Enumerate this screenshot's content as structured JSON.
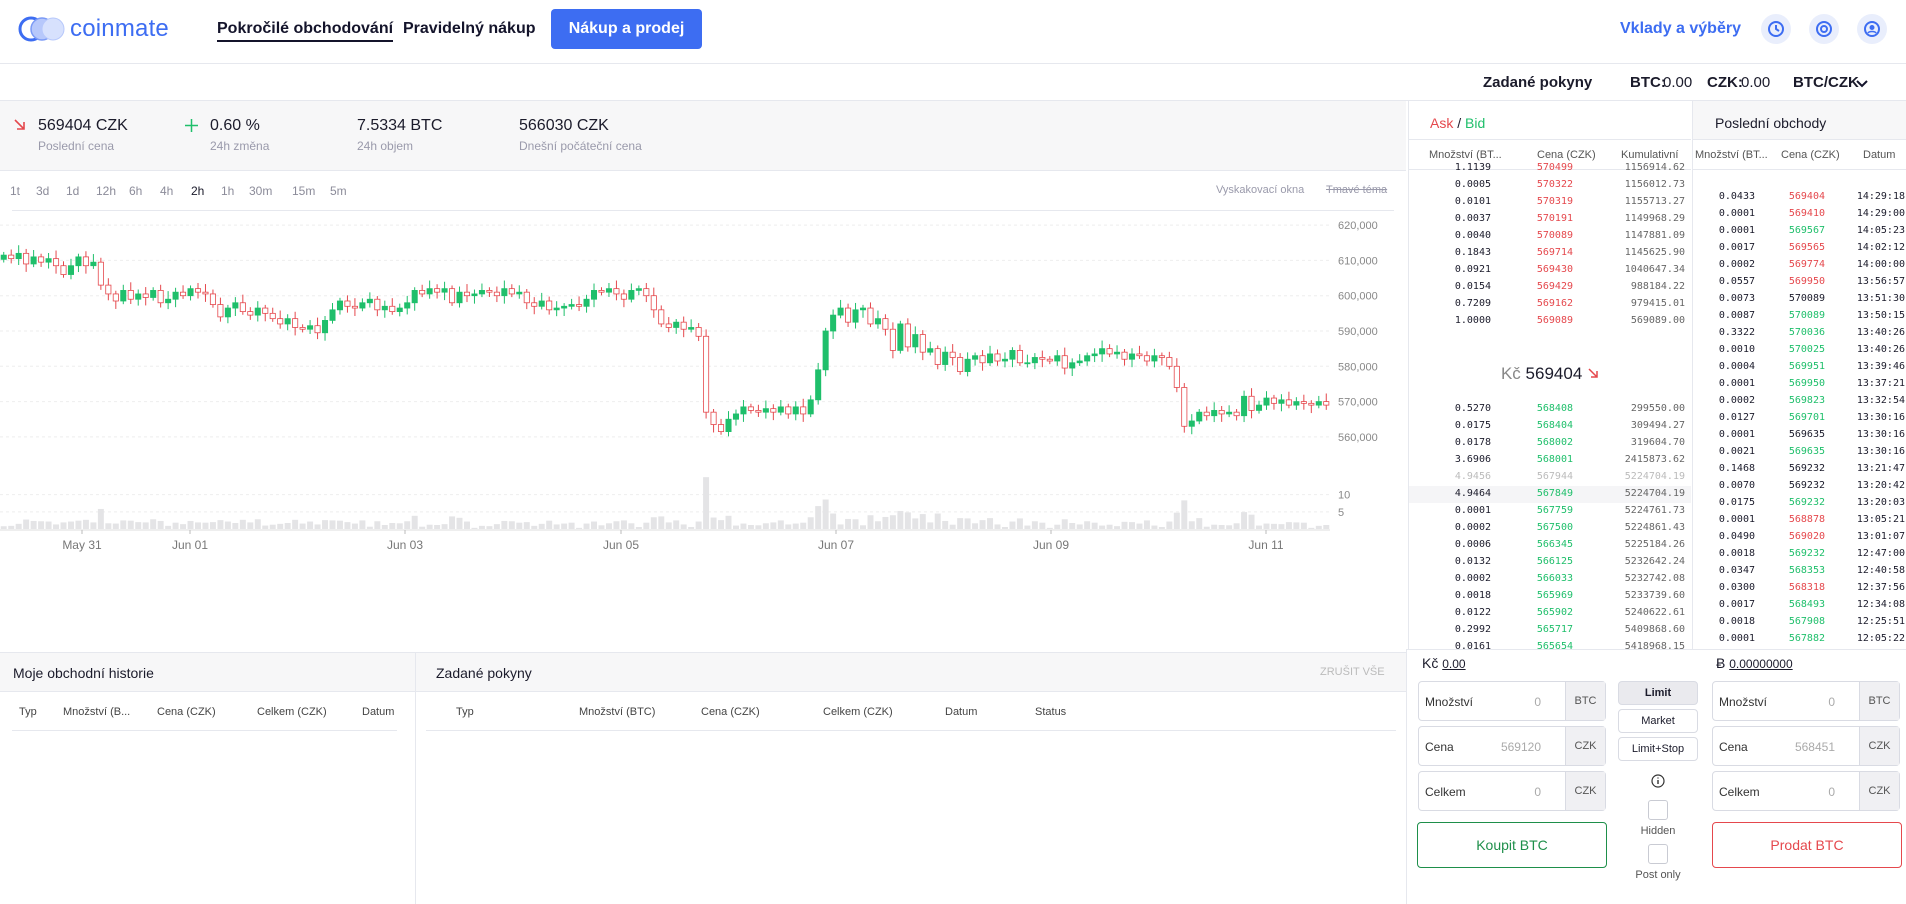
{
  "header": {
    "logo": "coinmate",
    "nav": [
      "Pokročilé obchodování",
      "Pravidelný nákup"
    ],
    "cta": "Nákup a prodej",
    "deposits": "Vklady a výběry",
    "icons": [
      "history-icon",
      "support-icon",
      "account-icon"
    ]
  },
  "subbar": {
    "orders": "Zadané pokyny",
    "btc_label": "BTC:",
    "btc_val": "0.00",
    "czk_label": "CZK:",
    "czk_val": "0.00",
    "pair": "BTC/CZK"
  },
  "ticker": [
    {
      "value": "569404 CZK",
      "label": "Poslední cena",
      "icon": "arrow-down-right-icon"
    },
    {
      "value": "0.60 %",
      "label": "24h změna",
      "icon": "plus-icon"
    },
    {
      "value": "7.5334 BTC",
      "label": "24h objem",
      "icon": ""
    },
    {
      "value": "566030 CZK",
      "label": "Dnešní počáteční cena",
      "icon": ""
    }
  ],
  "chart_controls": {
    "timeframes": [
      "1t",
      "3d",
      "1d",
      "12h",
      "6h",
      "4h",
      "2h",
      "1h",
      "30m",
      "15m",
      "5m"
    ],
    "active": "2h",
    "popup": "Vyskakovací okna",
    "dark": "Tmavé téma"
  },
  "chart_data": {
    "type": "candlestick",
    "x_tick_labels": [
      "May 31",
      "Jun 01",
      "Jun 03",
      "Jun 05",
      "Jun 07",
      "Jun 09",
      "Jun 11"
    ],
    "y_tick_labels": [
      "620,000",
      "610,000",
      "600,000",
      "590,000",
      "580,000",
      "570,000",
      "560,000"
    ],
    "volume_tick_labels": [
      "10",
      "5"
    ],
    "ylim": [
      556000,
      624000
    ],
    "volume_ylim": [
      0,
      16
    ],
    "close": [
      611500,
      610500,
      612000,
      609000,
      611000,
      609500,
      610500,
      608500,
      606000,
      608500,
      611000,
      608500,
      609500,
      603000,
      600500,
      598500,
      601500,
      599000,
      600500,
      599500,
      601500,
      598000,
      599000,
      601000,
      600000,
      602000,
      601000,
      600500,
      597500,
      594000,
      596500,
      598000,
      595500,
      594500,
      596500,
      595000,
      593500,
      592000,
      593500,
      591000,
      590500,
      591500,
      589500,
      593000,
      596000,
      598500,
      597000,
      596500,
      598000,
      599000,
      596000,
      597000,
      595500,
      596500,
      598000,
      601500,
      600500,
      602000,
      601000,
      602000,
      598000,
      601000,
      600000,
      600500,
      601500,
      601000,
      600000,
      602000,
      600500,
      601000,
      598000,
      597000,
      598500,
      596000,
      596500,
      597000,
      597500,
      597000,
      599000,
      601500,
      601000,
      602000,
      600500,
      599000,
      601500,
      602000,
      600000,
      596000,
      592000,
      591000,
      592500,
      590500,
      591000,
      588500,
      567000,
      563500,
      561500,
      565000,
      566500,
      568500,
      567500,
      567000,
      568000,
      567000,
      568500,
      566500,
      568500,
      566500,
      570500,
      579000,
      590000,
      594500,
      596500,
      592500,
      596000,
      596500,
      592000,
      593500,
      590500,
      584500,
      592000,
      585500,
      589000,
      584000,
      585000,
      580500,
      584000,
      582500,
      578500,
      582000,
      583000,
      581000,
      583500,
      581500,
      582000,
      584500,
      581000,
      581000,
      582500,
      582000,
      581500,
      583000,
      579500,
      581000,
      581500,
      583000,
      583500,
      585000,
      583500,
      584000,
      582000,
      583500,
      583000,
      581500,
      583000,
      582500,
      580000,
      574000,
      563000,
      564500,
      567000,
      566000,
      567500,
      566500,
      567000,
      566000,
      571500,
      567500,
      569000,
      571000,
      569500,
      570500,
      569000,
      570000,
      569500,
      569000,
      570000,
      569000
    ]
  },
  "orderbook": {
    "title_ask": "Ask",
    "title_sep": " / ",
    "title_bid": "Bid",
    "cols": [
      "Množství (BT...",
      "Cena (CZK)",
      "Kumulativní"
    ],
    "asks": [
      [
        "1.1139",
        "570499",
        "1156914.62"
      ],
      [
        "0.0005",
        "570322",
        "1156012.73"
      ],
      [
        "0.0101",
        "570319",
        "1155713.27"
      ],
      [
        "0.0037",
        "570191",
        "1149968.29"
      ],
      [
        "0.0040",
        "570089",
        "1147881.09"
      ],
      [
        "0.1843",
        "569714",
        "1145625.90"
      ],
      [
        "0.0921",
        "569430",
        "1040647.34"
      ],
      [
        "0.0154",
        "569429",
        "988184.22"
      ],
      [
        "0.7209",
        "569162",
        "979415.01"
      ],
      [
        "1.0000",
        "569089",
        "569089.00"
      ]
    ],
    "mid_currency": "Kč",
    "mid_price": "569404",
    "bids": [
      [
        "0.5270",
        "568408",
        "299550.00"
      ],
      [
        "0.0175",
        "568404",
        "309494.27"
      ],
      [
        "0.0178",
        "568002",
        "319604.70"
      ],
      [
        "3.6906",
        "568001",
        "2415873.62"
      ],
      [
        "4.9456",
        "567944",
        "5224704.19"
      ],
      [
        "4.9464",
        "567849",
        "5224704.19"
      ],
      [
        "0.0001",
        "567759",
        "5224761.73"
      ],
      [
        "0.0002",
        "567500",
        "5224861.43"
      ],
      [
        "0.0006",
        "566345",
        "5225184.26"
      ],
      [
        "0.0132",
        "566125",
        "5232642.24"
      ],
      [
        "0.0002",
        "566033",
        "5232742.08"
      ],
      [
        "0.0018",
        "565969",
        "5233739.60"
      ],
      [
        "0.0122",
        "565902",
        "5240622.61"
      ],
      [
        "0.2992",
        "565717",
        "5409868.60"
      ],
      [
        "0.0161",
        "565654",
        "5418968.15"
      ]
    ]
  },
  "last_trades": {
    "title": "Poslední obchody",
    "cols": [
      "Množství (BT...",
      "Cena (CZK)",
      "Datum"
    ],
    "rows": [
      [
        "0.0433",
        "569404",
        "14:29:18",
        "red"
      ],
      [
        "0.0001",
        "569410",
        "14:29:00",
        "red"
      ],
      [
        "0.0001",
        "569567",
        "14:05:23",
        "green"
      ],
      [
        "0.0017",
        "569565",
        "14:02:12",
        "red"
      ],
      [
        "0.0002",
        "569774",
        "14:00:00",
        "red"
      ],
      [
        "0.0557",
        "569950",
        "13:56:57",
        "red"
      ],
      [
        "0.0073",
        "570089",
        "13:51:30",
        "plain"
      ],
      [
        "0.0087",
        "570089",
        "13:50:15",
        "green"
      ],
      [
        "0.3322",
        "570036",
        "13:40:26",
        "green"
      ],
      [
        "0.0010",
        "570025",
        "13:40:26",
        "green"
      ],
      [
        "0.0004",
        "569951",
        "13:39:46",
        "green"
      ],
      [
        "0.0001",
        "569950",
        "13:37:21",
        "green"
      ],
      [
        "0.0002",
        "569823",
        "13:32:54",
        "green"
      ],
      [
        "0.0127",
        "569701",
        "13:30:16",
        "green"
      ],
      [
        "0.0001",
        "569635",
        "13:30:16",
        "plain"
      ],
      [
        "0.0021",
        "569635",
        "13:30:16",
        "green"
      ],
      [
        "0.1468",
        "569232",
        "13:21:47",
        "plain"
      ],
      [
        "0.0070",
        "569232",
        "13:20:42",
        "plain"
      ],
      [
        "0.0175",
        "569232",
        "13:20:03",
        "green"
      ],
      [
        "0.0001",
        "568878",
        "13:05:21",
        "red"
      ],
      [
        "0.0490",
        "569020",
        "13:01:07",
        "red"
      ],
      [
        "0.0018",
        "569232",
        "12:47:00",
        "green"
      ],
      [
        "0.0347",
        "568353",
        "12:40:58",
        "green"
      ],
      [
        "0.0300",
        "568318",
        "12:37:56",
        "red"
      ],
      [
        "0.0017",
        "568493",
        "12:34:08",
        "green"
      ],
      [
        "0.0018",
        "567908",
        "12:25:51",
        "green"
      ],
      [
        "0.0001",
        "567882",
        "12:05:22",
        "green"
      ]
    ]
  },
  "history": {
    "title": "Moje obchodní historie",
    "cols": [
      "Typ",
      "Množství (B...",
      "Cena (CZK)",
      "Celkem (CZK)",
      "Datum"
    ]
  },
  "orders": {
    "title": "Zadané pokyny",
    "cancel_all": "ZRUŠIT VŠE",
    "cols": [
      "Typ",
      "Množství (BTC)",
      "Cena (CZK)",
      "Celkem (CZK)",
      "Datum",
      "Status"
    ]
  },
  "trade": {
    "buy_balance_cur": "Kč",
    "buy_balance": "0.00",
    "sell_balance_cur": "Ƀ",
    "sell_balance": "0.00000000",
    "buy_fields": [
      {
        "label": "Množství",
        "value": "0",
        "unit": "BTC"
      },
      {
        "label": "Cena",
        "value": "569120",
        "unit": "CZK"
      },
      {
        "label": "Celkem",
        "value": "0",
        "unit": "CZK"
      }
    ],
    "sell_fields": [
      {
        "label": "Množství",
        "value": "0",
        "unit": "BTC"
      },
      {
        "label": "Cena",
        "value": "568451",
        "unit": "CZK"
      },
      {
        "label": "Celkem",
        "value": "0",
        "unit": "CZK"
      }
    ],
    "order_types": [
      "Limit",
      "Market",
      "Limit+Stop"
    ],
    "active_type": "Limit",
    "hidden": "Hidden",
    "post_only": "Post only",
    "buy": "Koupit BTC",
    "sell": "Prodat BTC"
  }
}
